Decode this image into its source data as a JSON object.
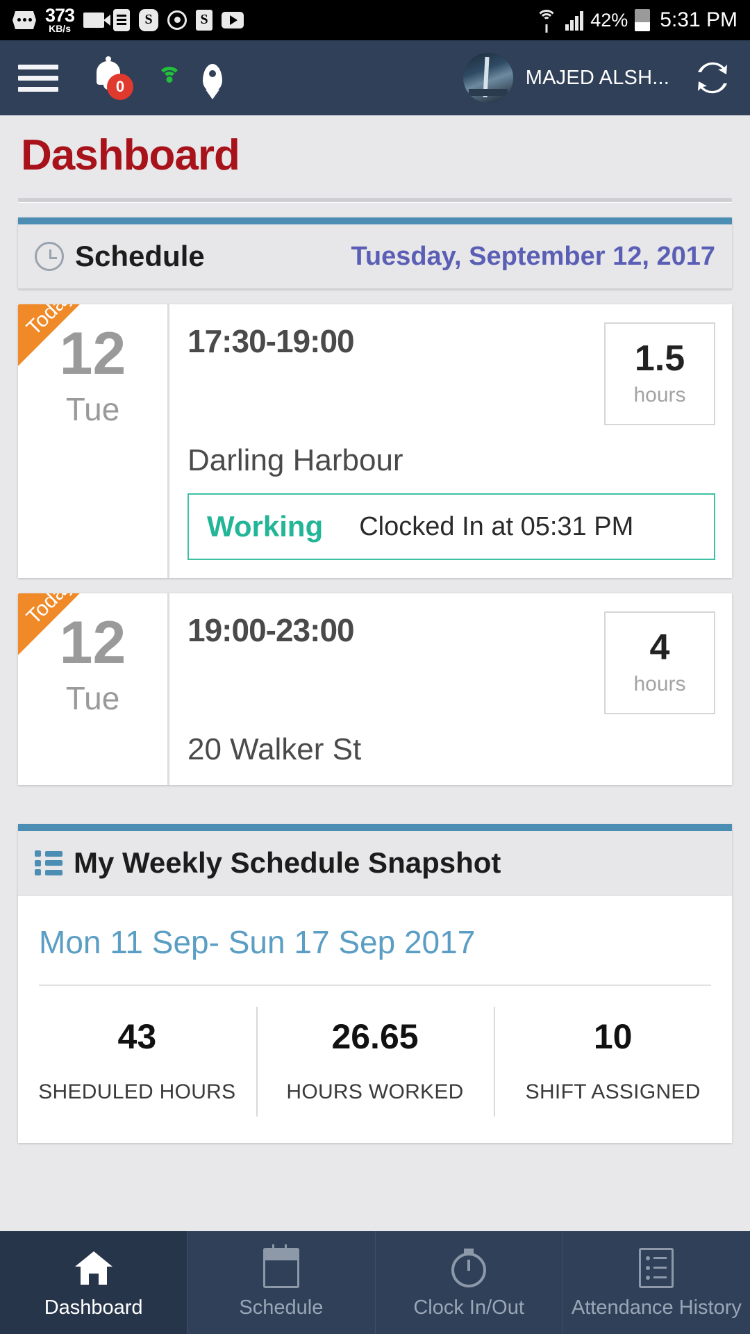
{
  "statusbar": {
    "net_speed_value": "373",
    "net_speed_unit": "KB/s",
    "battery_percent": "42%",
    "time": "5:31 PM",
    "icons": [
      "more-dots-icon",
      "video-camera-icon",
      "list-card-icon",
      "sync-s-icon",
      "gps-target-icon",
      "s-badge-icon",
      "play-icon",
      "wifi-icon",
      "signal-icon",
      "battery-icon"
    ]
  },
  "appbar": {
    "menu_icon": "hamburger-menu-icon",
    "notification_icon": "bell-icon",
    "notification_count": "0",
    "wifi_icon": "wifi-green-icon",
    "location_icon": "location-pin-icon",
    "username": "MAJED ALSH...",
    "refresh_icon": "refresh-icon"
  },
  "page": {
    "title": "Dashboard"
  },
  "schedule_panel": {
    "icon": "clock-icon",
    "title": "Schedule",
    "date": "Tuesday, September 12, 2017"
  },
  "shifts": [
    {
      "ribbon": "Today",
      "day_number": "12",
      "day_name": "Tue",
      "time_range": "17:30-19:00",
      "hours_value": "1.5",
      "hours_label": "hours",
      "location": "Darling Harbour",
      "status_label": "Working",
      "status_detail": "Clocked In at 05:31 PM"
    },
    {
      "ribbon": "Today",
      "day_number": "12",
      "day_name": "Tue",
      "time_range": "19:00-23:00",
      "hours_value": "4",
      "hours_label": "hours",
      "location": "20 Walker St",
      "status_label": "",
      "status_detail": ""
    }
  ],
  "snapshot_panel": {
    "icon": "list-icon",
    "title": "My Weekly Schedule Snapshot",
    "week_range": "Mon 11 Sep- Sun 17 Sep 2017",
    "stats": [
      {
        "value": "43",
        "label": "SHEDULED HOURS"
      },
      {
        "value": "26.65",
        "label": "HOURS WORKED"
      },
      {
        "value": "10",
        "label": "SHIFT ASSIGNED"
      }
    ]
  },
  "bottom_nav": [
    {
      "label": "Dashboard",
      "icon": "home-icon",
      "active": true
    },
    {
      "label": "Schedule",
      "icon": "calendar-icon",
      "active": false
    },
    {
      "label": "Clock In/Out",
      "icon": "stopwatch-icon",
      "active": false
    },
    {
      "label": "Attendance History",
      "icon": "list-lines-icon",
      "active": false
    }
  ],
  "colors": {
    "header_bg": "#2f4058",
    "title_red": "#a8131b",
    "panel_accent": "#4b8db3",
    "date_blue": "#5a5fb5",
    "ribbon_orange": "#f08a28",
    "status_teal": "#22b597",
    "week_blue": "#5b9ec4"
  }
}
